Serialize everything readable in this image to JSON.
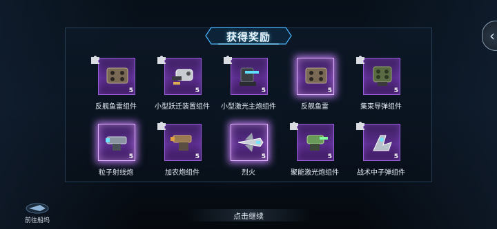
{
  "title": "获得奖励",
  "items": [
    {
      "name": "反舰鱼雷组件",
      "qty": "5",
      "fragment": true,
      "highlight": false,
      "icon": "torpedo-launcher-icon"
    },
    {
      "name": "小型跃迁装置组件",
      "qty": "5",
      "fragment": true,
      "highlight": false,
      "icon": "warp-device-icon"
    },
    {
      "name": "小型激光主炮组件",
      "qty": "5",
      "fragment": true,
      "highlight": false,
      "icon": "laser-cannon-icon"
    },
    {
      "name": "反舰鱼雷",
      "qty": "5",
      "fragment": false,
      "highlight": true,
      "icon": "torpedo-launcher-icon"
    },
    {
      "name": "集束导弹组件",
      "qty": "5",
      "fragment": true,
      "highlight": false,
      "icon": "missile-pod-icon"
    },
    {
      "name": "粒子射线炮",
      "qty": "5",
      "fragment": false,
      "highlight": true,
      "icon": "particle-cannon-icon"
    },
    {
      "name": "加农炮组件",
      "qty": "5",
      "fragment": true,
      "highlight": false,
      "icon": "cannon-icon"
    },
    {
      "name": "烈火",
      "qty": "5",
      "fragment": false,
      "highlight": true,
      "icon": "fighter-craft-icon"
    },
    {
      "name": "聚能激光炮组件",
      "qty": "5",
      "fragment": true,
      "highlight": false,
      "icon": "focus-laser-icon"
    },
    {
      "name": "战术中子弹组件",
      "qty": "5",
      "fragment": true,
      "highlight": false,
      "icon": "neutron-launcher-icon"
    }
  ],
  "continue_label": "点击继续",
  "dock_label": "前往船坞",
  "side_button_glyph": "‹",
  "colors": {
    "card": "#5a2d8c",
    "glow": "#e0b0ff",
    "accent": "#5ac8ff"
  }
}
